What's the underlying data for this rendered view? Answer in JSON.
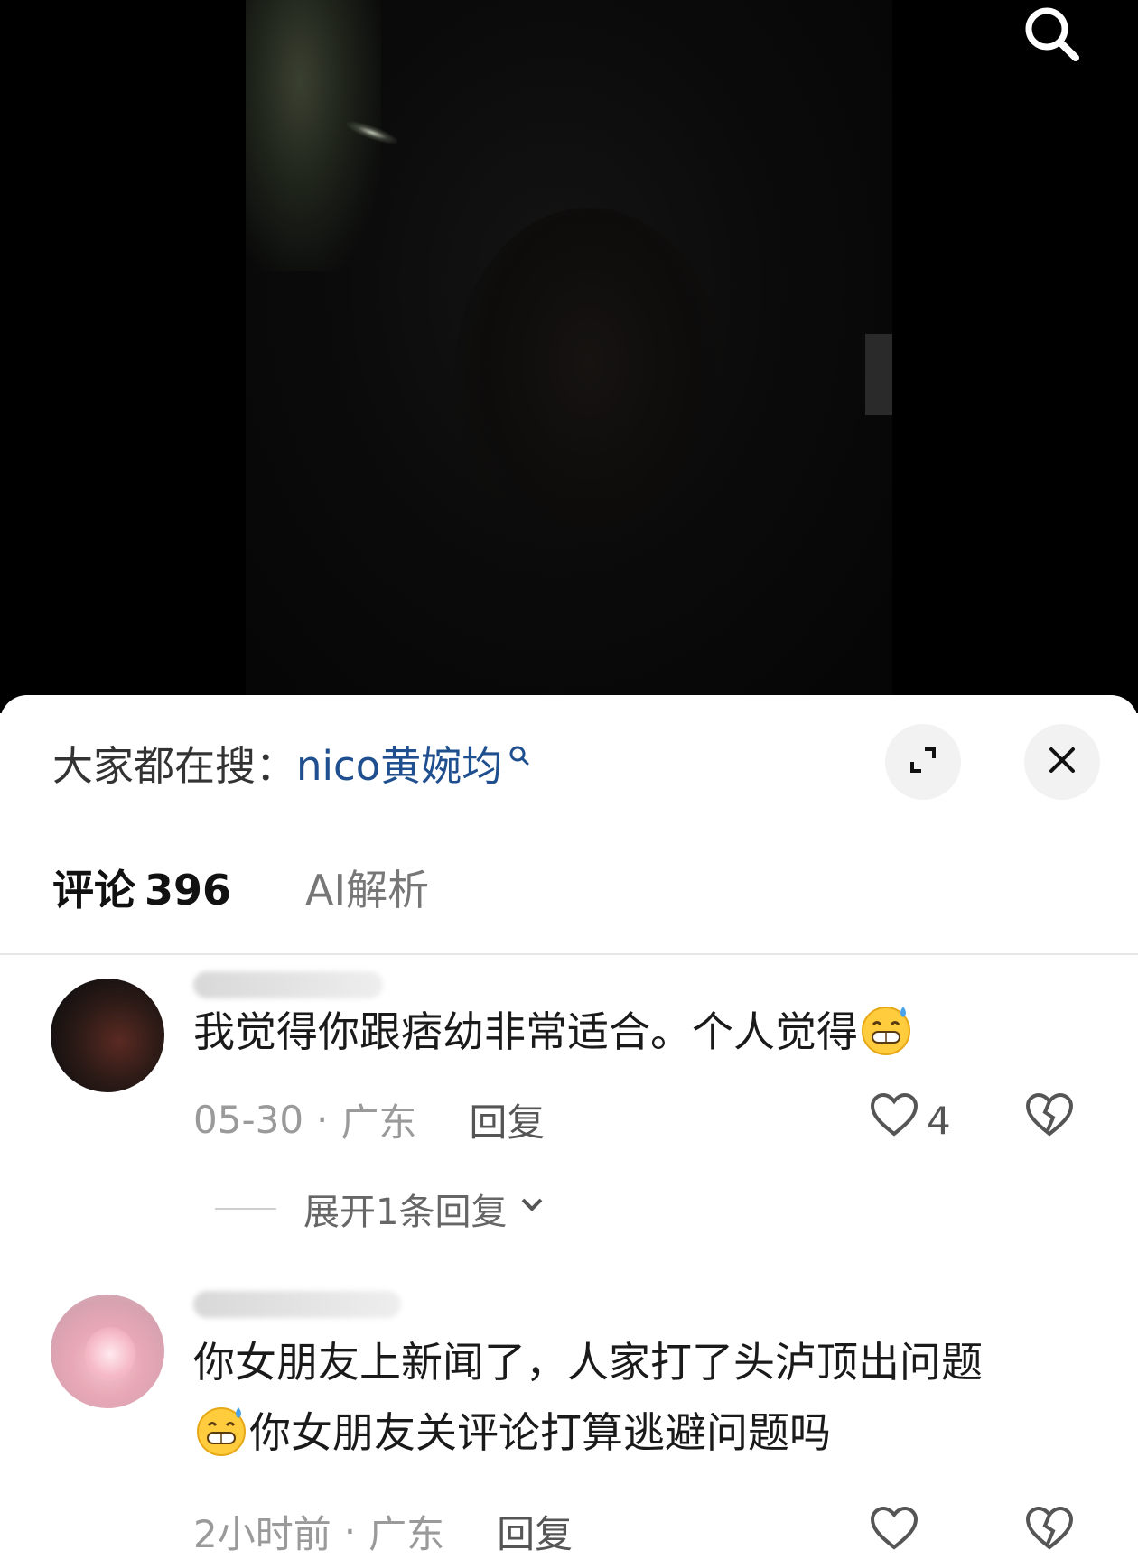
{
  "header": {
    "search_icon": "search-icon"
  },
  "sheet": {
    "search_prompt_label": "大家都在搜：",
    "search_keyword": "nico黄婉均",
    "expand_icon": "expand-icon",
    "close_icon": "close-icon"
  },
  "tabs": {
    "comments_label": "评论",
    "comments_count": "396",
    "ai_label": "AI解析"
  },
  "comments": [
    {
      "text": "我觉得你跟痞幼非常适合。个人觉得",
      "emoji": "grinning-sweat-emoji",
      "date": "05-30",
      "location": "广东",
      "reply_label": "回复",
      "likes": "4",
      "expand_replies_label": "展开1条回复"
    },
    {
      "text_line1": "你女朋友上新闻了，人家打了头泸顶出问题",
      "text_line2": "你女朋友关评论打算逃避问题吗",
      "emoji": "grinning-sweat-emoji",
      "date": "2小时前",
      "location": "广东",
      "reply_label": "回复"
    }
  ],
  "colors": {
    "keyword": "#1f4f8f",
    "meta": "#9a9a9a",
    "video_bg": "#000000"
  }
}
